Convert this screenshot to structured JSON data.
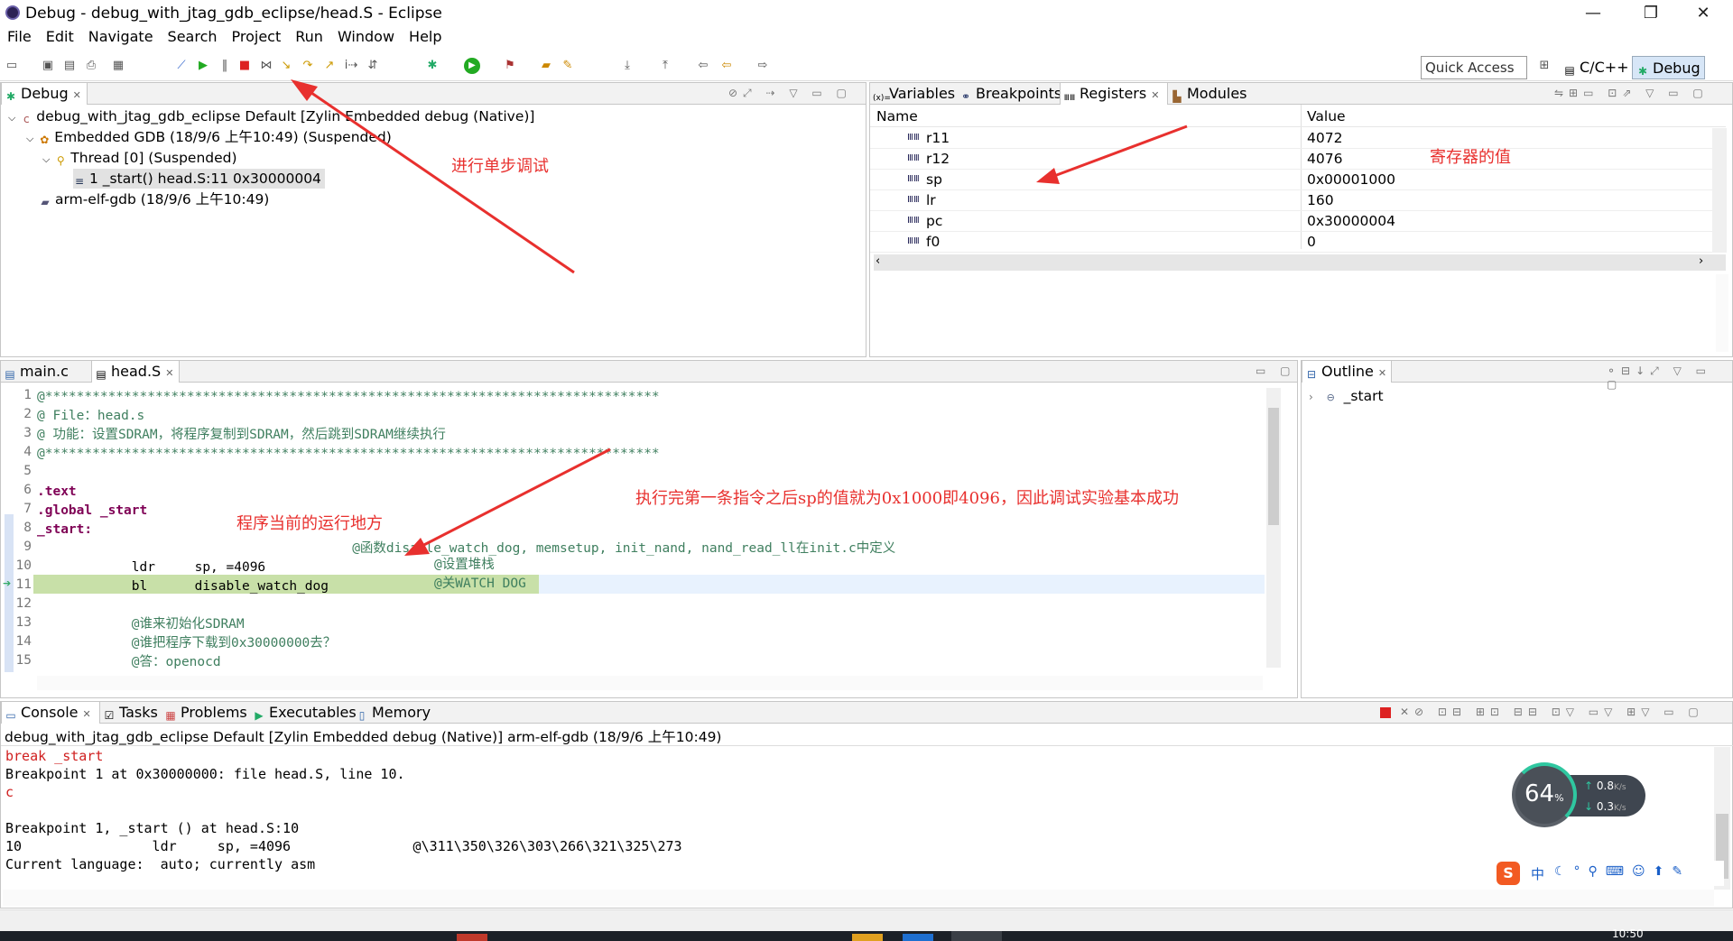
{
  "window": {
    "title": "Debug - debug_with_jtag_gdb_eclipse/head.S - Eclipse",
    "minimize": "—",
    "restore": "❐",
    "close": "✕"
  },
  "menu": [
    "File",
    "Edit",
    "Navigate",
    "Search",
    "Project",
    "Run",
    "Window",
    "Help"
  ],
  "toolbar": {
    "quick_access": "Quick Access",
    "persp_cpp": "C/C++",
    "persp_debug": "Debug"
  },
  "debug_view": {
    "tab": "Debug",
    "tree": [
      "debug_with_jtag_gdb_eclipse Default [Zylin Embedded debug (Native)]",
      "Embedded GDB (18/9/6 上午10:49) (Suspended)",
      "Thread [0] (Suspended)",
      "1 _start() head.S:11 0x30000004",
      "arm-elf-gdb (18/9/6 上午10:49)"
    ]
  },
  "vars_view": {
    "tabs": [
      "Variables",
      "Breakpoints",
      "Registers",
      "Modules"
    ],
    "col_name": "Name",
    "col_value": "Value",
    "rows": [
      {
        "name": "r11",
        "value": "4072"
      },
      {
        "name": "r12",
        "value": "4076"
      },
      {
        "name": "sp",
        "value": "0x00001000"
      },
      {
        "name": "lr",
        "value": "160"
      },
      {
        "name": "pc",
        "value": "0x30000004"
      },
      {
        "name": "f0",
        "value": "0"
      }
    ]
  },
  "editor": {
    "tabs": [
      "main.c",
      "head.S"
    ],
    "lines": [
      {
        "n": "1",
        "t": "@******************************************************************************",
        "c": "cmt"
      },
      {
        "n": "2",
        "t": "@ File：head.s",
        "c": "cmt"
      },
      {
        "n": "3",
        "t": "@ 功能：设置SDRAM，将程序复制到SDRAM，然后跳到SDRAM继续执行",
        "c": "cmt"
      },
      {
        "n": "4",
        "t": "@******************************************************************************",
        "c": "cmt"
      },
      {
        "n": "5",
        "t": "",
        "c": ""
      },
      {
        "n": "6",
        "t": ".text",
        "c": "kw"
      },
      {
        "n": "7",
        "t": ".global _start",
        "c": "kw"
      },
      {
        "n": "8",
        "t": "_start:",
        "c": "kw"
      },
      {
        "n": "9",
        "t": "                                        @函数disable_watch_dog, memsetup, init_nand, nand_read_ll在init.c中定义",
        "c": "cmt"
      },
      {
        "n": "10",
        "t": "            ldr     sp, =4096           ",
        "c": ""
      },
      {
        "n": "11",
        "t": "            bl      disable_watch_dog       ",
        "c": ""
      },
      {
        "n": "12",
        "t": "",
        "c": ""
      },
      {
        "n": "13",
        "t": "            @谁来初始化SDRAM",
        "c": "cmt"
      },
      {
        "n": "14",
        "t": "            @谁把程序下载到0x30000000去？",
        "c": "cmt"
      },
      {
        "n": "15",
        "t": "            @答：openocd",
        "c": "cmt"
      }
    ],
    "comment10": "@设置堆栈",
    "comment11": "@关WATCH DOG"
  },
  "outline": {
    "tab": "Outline",
    "item": "_start"
  },
  "console": {
    "tabs": [
      "Console",
      "Tasks",
      "Problems",
      "Executables",
      "Memory"
    ],
    "header": "debug_with_jtag_gdb_eclipse Default [Zylin Embedded debug (Native)] arm-elf-gdb (18/9/6 上午10:49)",
    "lines": [
      {
        "t": "break _start",
        "red": true
      },
      {
        "t": "Breakpoint 1 at 0x30000000: file head.S, line 10.",
        "red": false
      },
      {
        "t": "c",
        "red": true
      },
      {
        "t": "",
        "red": false
      },
      {
        "t": "Breakpoint 1, _start () at head.S:10",
        "red": false
      },
      {
        "t": "10                ldr     sp, =4096               @\\311\\350\\326\\303\\266\\321\\325\\273",
        "red": false
      },
      {
        "t": "Current language:  auto; currently asm",
        "red": false
      }
    ]
  },
  "annotations": {
    "step": "进行单步调试",
    "regs": "寄存器的值",
    "current": "程序当前的运行地方",
    "result": "执行完第一条指令之后sp的值就为0x1000即4096，因此调试实验基本成功"
  },
  "netwidget": {
    "percent": "64",
    "pct_sign": "%",
    "up": "0.8",
    "down": "0.3",
    "unit": "K/s"
  },
  "ime": {
    "label": "中"
  },
  "taskbar": {
    "clock": "10:50"
  }
}
